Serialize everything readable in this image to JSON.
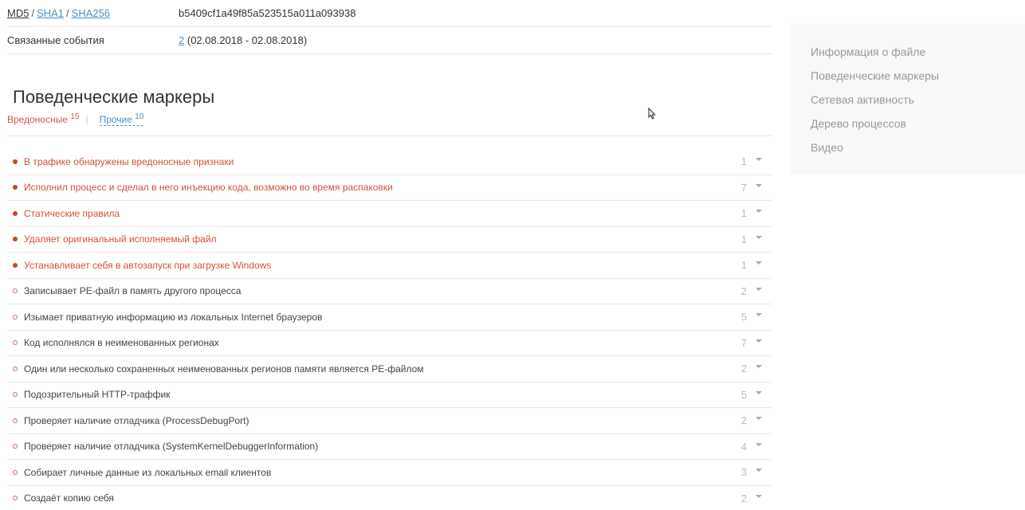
{
  "file_info": {
    "hashes_label": {
      "md5": "MD5",
      "sep1": "/",
      "sha1": "SHA1",
      "sep2": "/",
      "sha256": "SHA256"
    },
    "hash_value": "b5409cf1a49f85a523515a011a093938",
    "related_label": "Связанные события",
    "related_count": "2",
    "related_dates": "(02.08.2018 - 02.08.2018)"
  },
  "behavior": {
    "title": "Поведенческие маркеры",
    "filter_malicious": "Вредоносные",
    "filter_malicious_count": "15",
    "filter_divider": "|",
    "filter_other": "Прочие",
    "filter_other_count": "10",
    "markers": [
      {
        "text": "В трафике обнаружены вредоносные признаки",
        "count": "1",
        "malicious": true
      },
      {
        "text": "Исполнил процесс и сделал в него инъекцию кода, возможно во время распаковки",
        "count": "7",
        "malicious": true
      },
      {
        "text": "Статические правила",
        "count": "1",
        "malicious": true
      },
      {
        "text": "Удаляет оригинальный исполняемый файл",
        "count": "1",
        "malicious": true
      },
      {
        "text": "Устанавливает себя в автозапуск при загрузке Windows",
        "count": "1",
        "malicious": true
      },
      {
        "text": "Записывает PE-файл в память другого процесса",
        "count": "2",
        "malicious": false
      },
      {
        "text": "Изымает приватную информацию из локальных Internet браузеров",
        "count": "5",
        "malicious": false
      },
      {
        "text": "Код исполнялся в неименованных регионах",
        "count": "7",
        "malicious": false
      },
      {
        "text": "Один или несколько сохраненных неименованных регионов памяти является PE-файлом",
        "count": "2",
        "malicious": false
      },
      {
        "text": "Подозрительный HTTP-траффик",
        "count": "5",
        "malicious": false
      },
      {
        "text": "Проверяет наличие отладчика (ProcessDebugPort)",
        "count": "2",
        "malicious": false
      },
      {
        "text": "Проверяет наличие отладчика (SystemKernelDebuggerInformation)",
        "count": "4",
        "malicious": false
      },
      {
        "text": "Собирает личные данные из локальных email клиентов",
        "count": "3",
        "malicious": false
      },
      {
        "text": "Создаёт копию себя",
        "count": "2",
        "malicious": false
      }
    ]
  },
  "sidebar": {
    "items": [
      {
        "label": "Информация о файле"
      },
      {
        "label": "Поведенческие маркеры"
      },
      {
        "label": "Сетевая активность"
      },
      {
        "label": "Дерево процессов"
      },
      {
        "label": "Видео"
      }
    ]
  },
  "colors": {
    "malicious": "#d4503a",
    "link": "#4a90c8",
    "sidebar_bg": "#f8f9fa"
  },
  "icons": {
    "marker_bullet": "dot-icon",
    "expand": "chevron-down-icon",
    "cursor": "mouse-pointer-icon"
  }
}
